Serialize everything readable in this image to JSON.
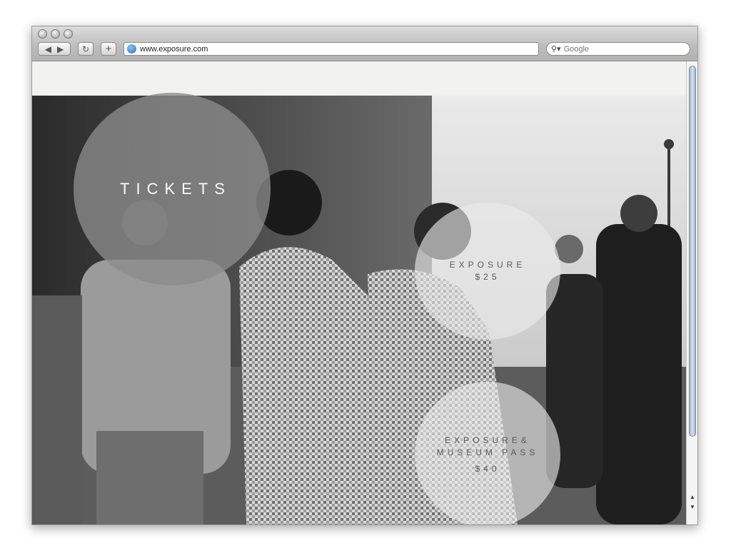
{
  "browser": {
    "url": "www.exposure.com",
    "search_placeholder": "Google"
  },
  "page": {
    "tickets_label": "TICKETS",
    "offers": [
      {
        "lines": [
          "EXPOSURE",
          "$25"
        ]
      },
      {
        "lines": [
          "EXPOSURE&",
          "MUSEUM PASS",
          "$40"
        ]
      }
    ]
  },
  "colors": {
    "tickets_circle": "#8c8c8c",
    "offer_circle": "#ebebeb",
    "offer_text": "#5a5a5a"
  }
}
